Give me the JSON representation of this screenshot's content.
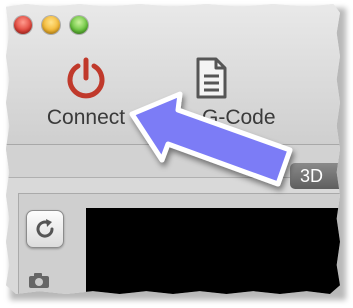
{
  "window": {
    "controls": [
      "close",
      "minimize",
      "zoom"
    ]
  },
  "toolbar": {
    "items": [
      {
        "label": "Connect",
        "icon": "power-icon",
        "color": "#c0392b"
      },
      {
        "label": "G-Code",
        "icon": "document-icon",
        "color": "#555555"
      }
    ]
  },
  "tabs": {
    "view_3d_label": "3D"
  },
  "panel": {
    "refresh_icon": "refresh-icon",
    "camera_icon": "camera-icon"
  },
  "annotation": {
    "arrow_color": "#7b7cf6",
    "points_to": "Connect"
  }
}
